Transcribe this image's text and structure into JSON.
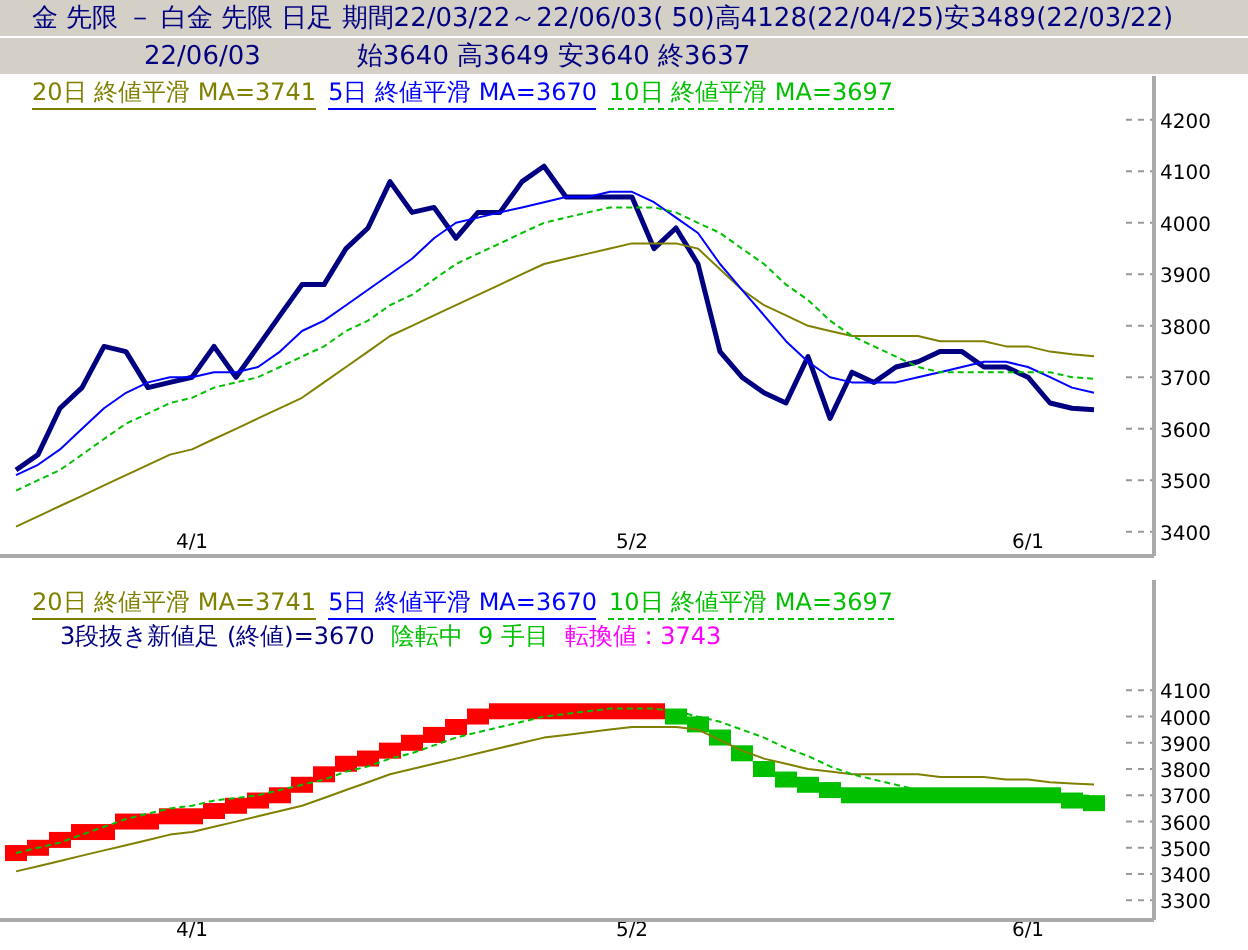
{
  "header": {
    "title": "金 先限 － 白金 先限 日足 期間22/03/22～22/06/03( 50)高4128(22/04/25)安3489(22/03/22)",
    "date": "22/06/03",
    "ohlc": "始3640 高3649 安3640 終3637"
  },
  "price_chart": {
    "chart_data": {
      "type": "line",
      "categories": [
        null,
        null,
        null,
        null,
        null,
        null,
        null,
        null,
        "4/1",
        null,
        null,
        null,
        null,
        null,
        null,
        null,
        null,
        null,
        null,
        null,
        null,
        null,
        null,
        null,
        null,
        null,
        null,
        null,
        "5/2",
        null,
        null,
        null,
        null,
        null,
        null,
        null,
        null,
        null,
        null,
        null,
        null,
        null,
        null,
        null,
        null,
        null,
        "6/1",
        null,
        null,
        null
      ],
      "ylim": [
        3353,
        4285
      ],
      "yticks": [
        3400,
        3500,
        3600,
        3700,
        3800,
        3900,
        4000,
        4100,
        4200
      ],
      "series": [
        {
          "color": "#000080",
          "line_style": "solid",
          "values": [
            3520,
            3550,
            3640,
            3680,
            3760,
            3750,
            3680,
            3690,
            3700,
            3760,
            3700,
            3760,
            3820,
            3880,
            3880,
            3950,
            3990,
            4080,
            4020,
            4030,
            3970,
            4020,
            4020,
            4080,
            4110,
            4050,
            4050,
            4050,
            4050,
            3950,
            3990,
            3920,
            3750,
            3700,
            3670,
            3650,
            3740,
            3620,
            3710,
            3690,
            3720,
            3730,
            3750,
            3750,
            3720,
            3720,
            3700,
            3650,
            3640,
            3637
          ]
        },
        {
          "name": "20日 終値平滑 MA=3741",
          "color": "#808000",
          "line_style": "solid",
          "values": [
            3410,
            3430,
            3450,
            3470,
            3490,
            3510,
            3530,
            3550,
            3560,
            3580,
            3600,
            3620,
            3640,
            3660,
            3690,
            3720,
            3750,
            3780,
            3800,
            3820,
            3840,
            3860,
            3880,
            3900,
            3920,
            3930,
            3940,
            3950,
            3960,
            3960,
            3960,
            3950,
            3910,
            3870,
            3840,
            3820,
            3800,
            3790,
            3780,
            3780,
            3780,
            3780,
            3770,
            3770,
            3770,
            3760,
            3760,
            3750,
            3745,
            3741
          ]
        },
        {
          "name": "5日 終値平滑 MA=3670",
          "color": "#0000ff",
          "line_style": "solid",
          "values": [
            3510,
            3530,
            3560,
            3600,
            3640,
            3670,
            3690,
            3700,
            3700,
            3710,
            3710,
            3720,
            3750,
            3790,
            3810,
            3840,
            3870,
            3900,
            3930,
            3970,
            4000,
            4010,
            4020,
            4030,
            4040,
            4050,
            4050,
            4060,
            4060,
            4040,
            4010,
            3980,
            3920,
            3870,
            3820,
            3770,
            3730,
            3700,
            3690,
            3690,
            3690,
            3700,
            3710,
            3720,
            3730,
            3730,
            3720,
            3700,
            3680,
            3670
          ]
        },
        {
          "name": "10日 終値平滑 MA=3697",
          "color": "#00c000",
          "line_style": "dashed",
          "values": [
            3480,
            3500,
            3520,
            3550,
            3580,
            3610,
            3630,
            3650,
            3660,
            3680,
            3690,
            3700,
            3720,
            3740,
            3760,
            3790,
            3810,
            3840,
            3860,
            3890,
            3920,
            3940,
            3960,
            3980,
            4000,
            4010,
            4020,
            4030,
            4030,
            4030,
            4020,
            4000,
            3980,
            3950,
            3920,
            3880,
            3850,
            3810,
            3780,
            3760,
            3740,
            3720,
            3710,
            3710,
            3710,
            3710,
            3710,
            3710,
            3700,
            3697
          ]
        }
      ]
    }
  },
  "break_chart": {
    "legend": [
      {
        "text": "20日 終値平滑 MA=3741",
        "color": "#808000",
        "dashed": false
      },
      {
        "text": "5日 終値平滑 MA=3670",
        "color": "#0000ff",
        "dashed": false
      },
      {
        "text": "10日 終値平滑 MA=3697",
        "color": "#00c000",
        "dashed": true
      }
    ],
    "info": [
      {
        "text": "3段抜き新値足 (終値)=3670",
        "color": "#000080"
      },
      {
        "text": "陰転中  9 手目",
        "color": "#00c000"
      },
      {
        "text": "転換値 : 3743",
        "color": "#ff00ff"
      }
    ],
    "chart_data": {
      "type": "line",
      "categories": [
        null,
        null,
        null,
        null,
        null,
        null,
        null,
        null,
        "4/1",
        null,
        null,
        null,
        null,
        null,
        null,
        null,
        null,
        null,
        null,
        null,
        null,
        null,
        null,
        null,
        null,
        null,
        null,
        null,
        "5/2",
        null,
        null,
        null,
        null,
        null,
        null,
        null,
        null,
        null,
        null,
        null,
        null,
        null,
        null,
        null,
        null,
        null,
        "6/1",
        null,
        null,
        null
      ],
      "ylim": [
        3225,
        4520
      ],
      "yticks": [
        3300,
        3400,
        3500,
        3600,
        3700,
        3800,
        3900,
        4000,
        4100
      ],
      "series": [
        {
          "type": "scatter",
          "color": "#ff0000",
          "values": [
            3480,
            3500,
            3530,
            3560,
            3560,
            3600,
            3600,
            3620,
            3620,
            3640,
            3660,
            3680,
            3700,
            3740,
            3780,
            3820,
            3840,
            3870,
            3900,
            3930,
            3960,
            4000,
            4020,
            4020,
            4020,
            4020,
            4020,
            4020,
            4020,
            4020,
            null,
            null,
            null,
            null,
            null,
            null,
            null,
            null,
            null,
            null,
            null,
            null,
            null,
            null,
            null,
            null,
            null,
            null,
            null,
            null
          ]
        },
        {
          "type": "scatter",
          "color": "#00c000",
          "values": [
            null,
            null,
            null,
            null,
            null,
            null,
            null,
            null,
            null,
            null,
            null,
            null,
            null,
            null,
            null,
            null,
            null,
            null,
            null,
            null,
            null,
            null,
            null,
            null,
            null,
            null,
            null,
            null,
            null,
            null,
            4000,
            3970,
            3920,
            3860,
            3800,
            3760,
            3740,
            3720,
            3700,
            3700,
            3700,
            3700,
            3700,
            3700,
            3700,
            3700,
            3700,
            3700,
            3680,
            3670
          ]
        },
        {
          "color": "#808000",
          "line_style": "solid",
          "values": [
            3410,
            3430,
            3450,
            3470,
            3490,
            3510,
            3530,
            3550,
            3560,
            3580,
            3600,
            3620,
            3640,
            3660,
            3690,
            3720,
            3750,
            3780,
            3800,
            3820,
            3840,
            3860,
            3880,
            3900,
            3920,
            3930,
            3940,
            3950,
            3960,
            3960,
            3960,
            3950,
            3910,
            3870,
            3840,
            3820,
            3800,
            3790,
            3780,
            3780,
            3780,
            3780,
            3770,
            3770,
            3770,
            3760,
            3760,
            3750,
            3745,
            3741
          ]
        },
        {
          "color": "#00c000",
          "line_style": "dashed",
          "values": [
            3480,
            3500,
            3520,
            3550,
            3580,
            3610,
            3630,
            3650,
            3660,
            3680,
            3690,
            3700,
            3720,
            3740,
            3760,
            3790,
            3810,
            3840,
            3860,
            3890,
            3920,
            3940,
            3960,
            3980,
            4000,
            4010,
            4020,
            4030,
            4030,
            4030,
            4020,
            4000,
            3980,
            3950,
            3920,
            3880,
            3850,
            3810,
            3780,
            3760,
            3740,
            3720,
            3710,
            3710,
            3710,
            3710,
            3710,
            3710,
            3700,
            3697
          ]
        }
      ]
    }
  }
}
